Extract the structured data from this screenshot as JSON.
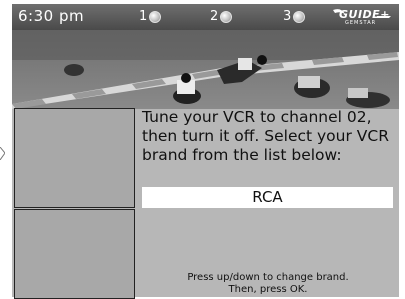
{
  "status_bar": {
    "time": "6:30 pm",
    "slots": [
      "1",
      "2",
      "3"
    ],
    "logo_text": "GUIDE+",
    "logo_subtext": "GEMSTAR"
  },
  "setup": {
    "message": "Tune your VCR to channel 02, then turn it off. Select your VCR brand from the list below:",
    "selected_brand": "RCA",
    "help_line1": "Press up/down to change brand.",
    "help_line2": "Then, press OK."
  }
}
